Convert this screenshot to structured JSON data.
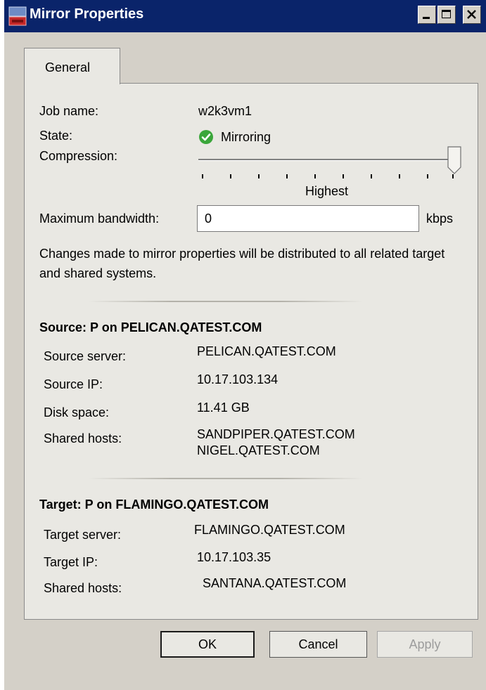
{
  "window": {
    "title": "Mirror Properties"
  },
  "tabs": [
    {
      "label": "General"
    }
  ],
  "general": {
    "job_name_label": "Job name:",
    "job_name_value": "w2k3vm1",
    "state_label": "State:",
    "state_value": "Mirroring",
    "state_icon": "check-circle-icon",
    "compression_label": "Compression:",
    "compression_level_label": "Highest",
    "compression_level": 1.0,
    "max_bandwidth_label": "Maximum bandwidth:",
    "max_bandwidth_value": "0",
    "max_bandwidth_unit": "kbps",
    "note": "Changes made to mirror properties will be distributed to all related target and shared systems."
  },
  "source": {
    "heading": "Source: P on PELICAN.QATEST.COM",
    "server_label": "Source server:",
    "server_value": "PELICAN.QATEST.COM",
    "ip_label": "Source IP:",
    "ip_value": "10.17.103.134",
    "disk_label": "Disk space:",
    "disk_value": "11.41 GB",
    "shared_label": "Shared hosts:",
    "shared_hosts": [
      "SANDPIPER.QATEST.COM",
      "NIGEL.QATEST.COM"
    ]
  },
  "target": {
    "heading": "Target: P on FLAMINGO.QATEST.COM",
    "server_label": "Target server:",
    "server_value": "FLAMINGO.QATEST.COM",
    "ip_label": "Target IP:",
    "ip_value": "10.17.103.35",
    "shared_label": "Shared hosts:",
    "shared_hosts": [
      "SANTANA.QATEST.COM"
    ]
  },
  "buttons": {
    "ok": "OK",
    "cancel": "Cancel",
    "apply": "Apply"
  },
  "colors": {
    "titlebar": "#0a246a",
    "state_ok": "#3aa63a",
    "dialog_bg": "#e9e8e3"
  }
}
